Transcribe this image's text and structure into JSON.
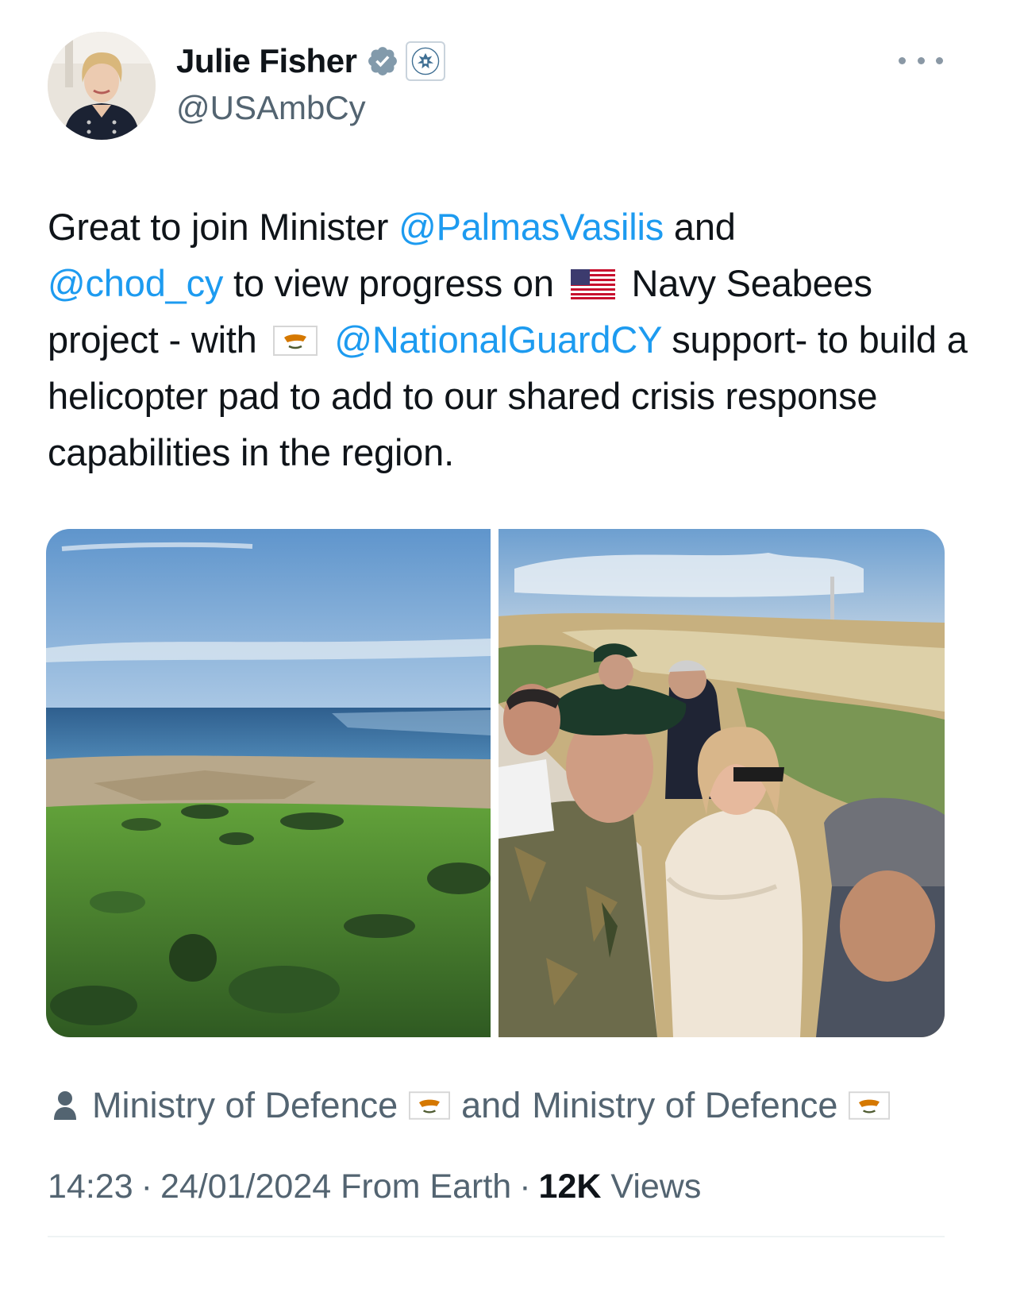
{
  "author": {
    "name": "Julie Fisher",
    "handle": "@USAmbCy",
    "verified_icon": "verified-badge-icon",
    "affiliation_icon": "us-great-seal-icon"
  },
  "tweet": {
    "t1": "Great to join Minister ",
    "m1": "@PalmasVasilis",
    "t2": " and",
    "m2": "@chod_cy",
    "t3": " to view progress on",
    "t4": "Navy Seabees project - with",
    "m3": "@NationalGuardCY",
    "t5": " support- to build a helicopter pad to add to our shared crisis response capabilities in the region."
  },
  "media": {
    "photo1": "coastal landscape photo",
    "photo2": "group at overlook photo"
  },
  "tagged": {
    "account1": "Ministry of Defence",
    "joiner": "and",
    "account2": "Ministry of Defence"
  },
  "meta": {
    "time": "14:23",
    "sep": "·",
    "date": "24/01/2024",
    "source": "From Earth",
    "views_count": "12K",
    "views_label": "Views"
  },
  "colors": {
    "link": "#1d9bf0",
    "verified": "#829aab",
    "secondary": "#536471"
  }
}
